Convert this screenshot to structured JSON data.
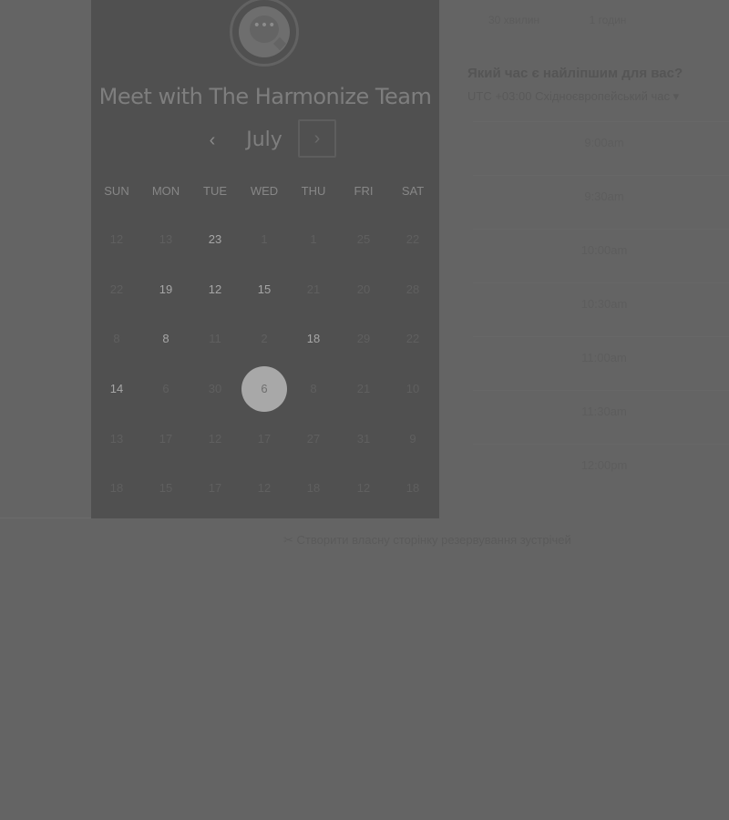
{
  "scheduler": {
    "title": "Meet with The Harmonize Team",
    "logo_icon": "chat-bubble-icon",
    "calendar": {
      "month": "July",
      "prev_icon": "‹",
      "next_icon": "›",
      "weekdays": [
        "SUN",
        "MON",
        "TUE",
        "WED",
        "THU",
        "FRI",
        "SAT"
      ],
      "weeks": [
        [
          "12",
          "13",
          "23",
          "1",
          "1",
          "25",
          "22"
        ],
        [
          "22",
          "19",
          "12",
          "15",
          "21",
          "20",
          "28"
        ],
        [
          "8",
          "8",
          "11",
          "2",
          "18",
          "29",
          "22"
        ],
        [
          "14",
          "6",
          "30",
          "6",
          "8",
          "21",
          "10"
        ],
        [
          "13",
          "17",
          "12",
          "17",
          "27",
          "31",
          "9"
        ],
        [
          "18",
          "15",
          "17",
          "12",
          "18",
          "12",
          "18"
        ]
      ],
      "available": [
        [
          false,
          false,
          true,
          false,
          false,
          false,
          false
        ],
        [
          false,
          true,
          true,
          true,
          false,
          false,
          false
        ],
        [
          false,
          true,
          false,
          false,
          true,
          false,
          false
        ],
        [
          true,
          false,
          false,
          false,
          false,
          false,
          false
        ],
        [
          false,
          false,
          false,
          false,
          false,
          false,
          false
        ],
        [
          false,
          false,
          false,
          false,
          false,
          false,
          false
        ]
      ],
      "selected_week": 3,
      "selected_day": 3
    }
  },
  "durations": [
    "30 хвилин",
    "1 годин"
  ],
  "time_question": "Який час є найліпшим для вас?",
  "timezone": "UTC +03:00 Східноєвропейський час ▾",
  "time_slots": [
    "9:00am",
    "9:30am",
    "10:00am",
    "10:30am",
    "11:00am",
    "11:30am",
    "12:00pm"
  ],
  "footer_link": "✂ Створити власну сторінку резервування зустрічей",
  "colors": {
    "overlay_bg": "#646464",
    "card_bg": "#505050",
    "selected_circle": "#a8a8a8"
  }
}
